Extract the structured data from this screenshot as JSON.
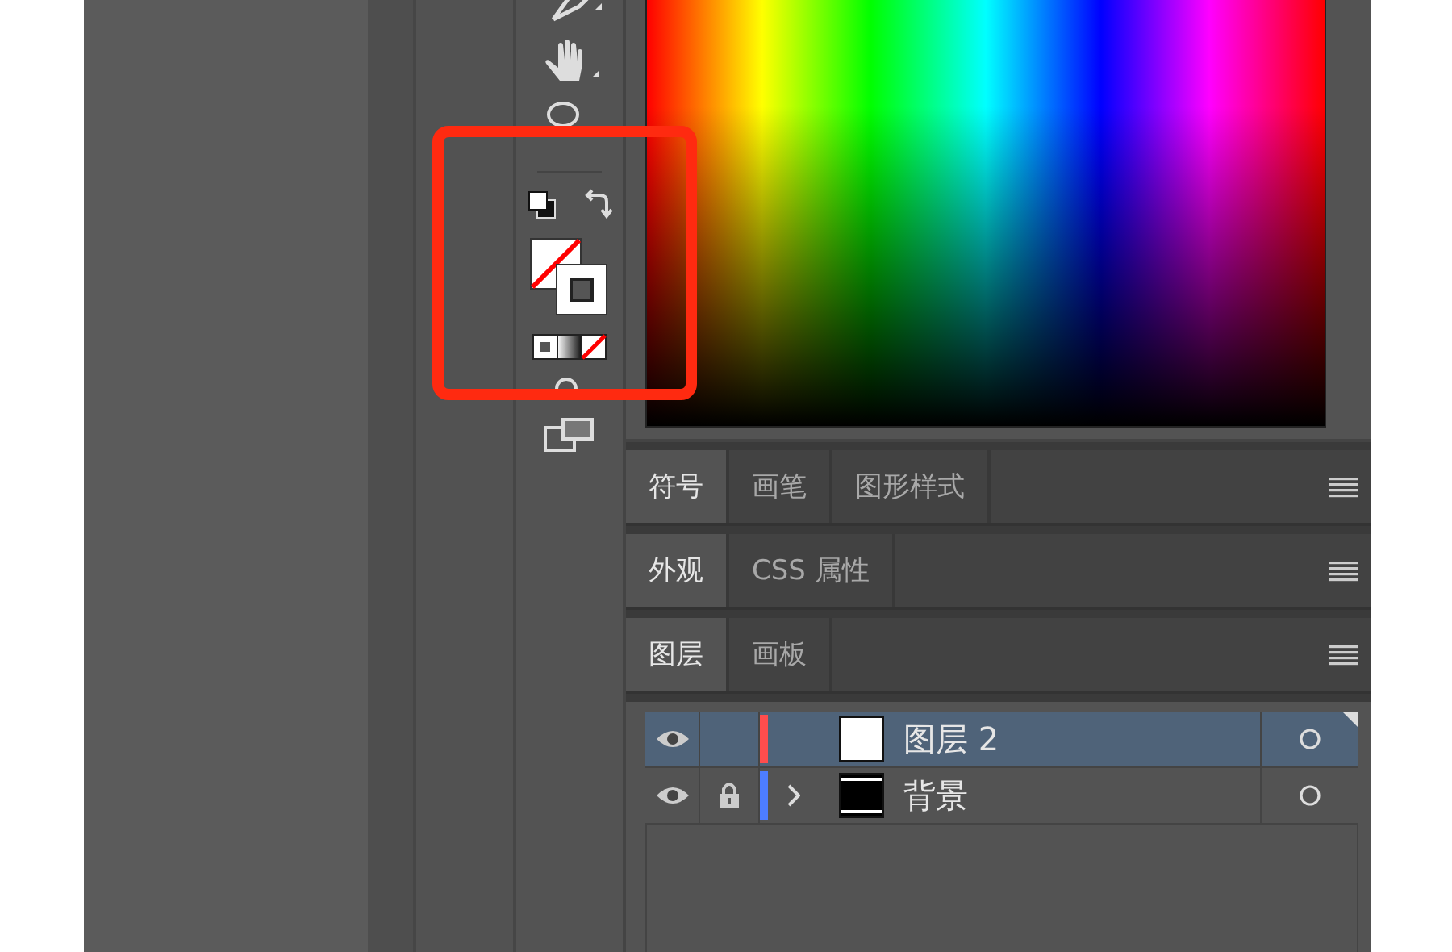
{
  "panel_groups": [
    {
      "tabs": [
        {
          "label": "符号",
          "selected": true
        },
        {
          "label": "画笔",
          "selected": false
        },
        {
          "label": "图形样式",
          "selected": false
        }
      ]
    },
    {
      "tabs": [
        {
          "label": "外观",
          "selected": true
        },
        {
          "label": "CSS 属性",
          "selected": false
        }
      ]
    },
    {
      "tabs": [
        {
          "label": "图层",
          "selected": true
        },
        {
          "label": "画板",
          "selected": false
        }
      ]
    }
  ],
  "layers": [
    {
      "name": "图层 2",
      "visible": true,
      "locked": false,
      "color": "#ff4d4d",
      "has_children": false,
      "kind": "white",
      "selected": true
    },
    {
      "name": "背景",
      "visible": true,
      "locked": true,
      "color": "#4d7dff",
      "has_children": true,
      "kind": "black",
      "selected": false
    }
  ]
}
